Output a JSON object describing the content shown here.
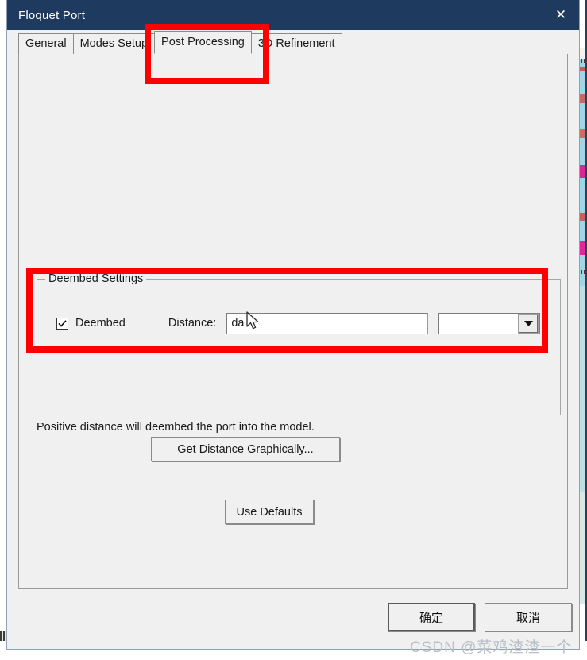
{
  "window": {
    "title": "Floquet Port",
    "close_label": "✕",
    "titlebar_color": "#1f3a5f"
  },
  "tabs": [
    {
      "label": "General",
      "selected": false
    },
    {
      "label": "Modes Setup",
      "selected": false
    },
    {
      "label": "Post Processing",
      "selected": true
    },
    {
      "label": "3D Refinement",
      "selected": false
    }
  ],
  "deembed_group": {
    "legend": "Deembed Settings",
    "checkbox": {
      "label": "Deembed",
      "checked": true
    },
    "distance_label": "Distance:",
    "distance_value": "da",
    "unit_value": "",
    "unit_dropdown_icon": "chevron-down-icon"
  },
  "hint": "Positive distance will deembed the port into the model.",
  "buttons": {
    "get_distance": "Get Distance Graphically...",
    "use_defaults": "Use Defaults",
    "ok": "确定",
    "cancel": "取消"
  },
  "annotations": {
    "accent_color": "#fe0000",
    "boxes": [
      {
        "name": "post-processing-tab-highlight"
      },
      {
        "name": "deembed-settings-highlight"
      }
    ]
  },
  "watermark": "CSDN @菜鸡渣渣一个"
}
